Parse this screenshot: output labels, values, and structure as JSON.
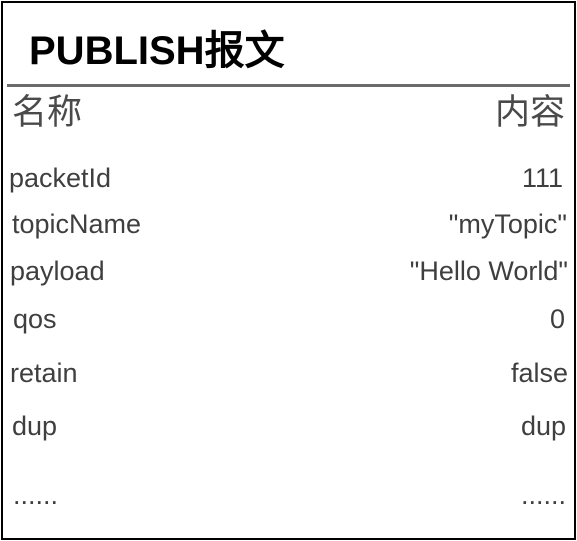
{
  "title": "PUBLISH报文",
  "headers": {
    "name": "名称",
    "content": "内容"
  },
  "rows": [
    {
      "name": "packetId",
      "value": "111"
    },
    {
      "name": "topicName",
      "value": "\"myTopic\""
    },
    {
      "name": "payload",
      "value": "\"Hello World\""
    },
    {
      "name": "qos",
      "value": "0"
    },
    {
      "name": "retain",
      "value": "false"
    },
    {
      "name": "dup",
      "value": "dup"
    },
    {
      "name": "......",
      "value": "......"
    }
  ]
}
